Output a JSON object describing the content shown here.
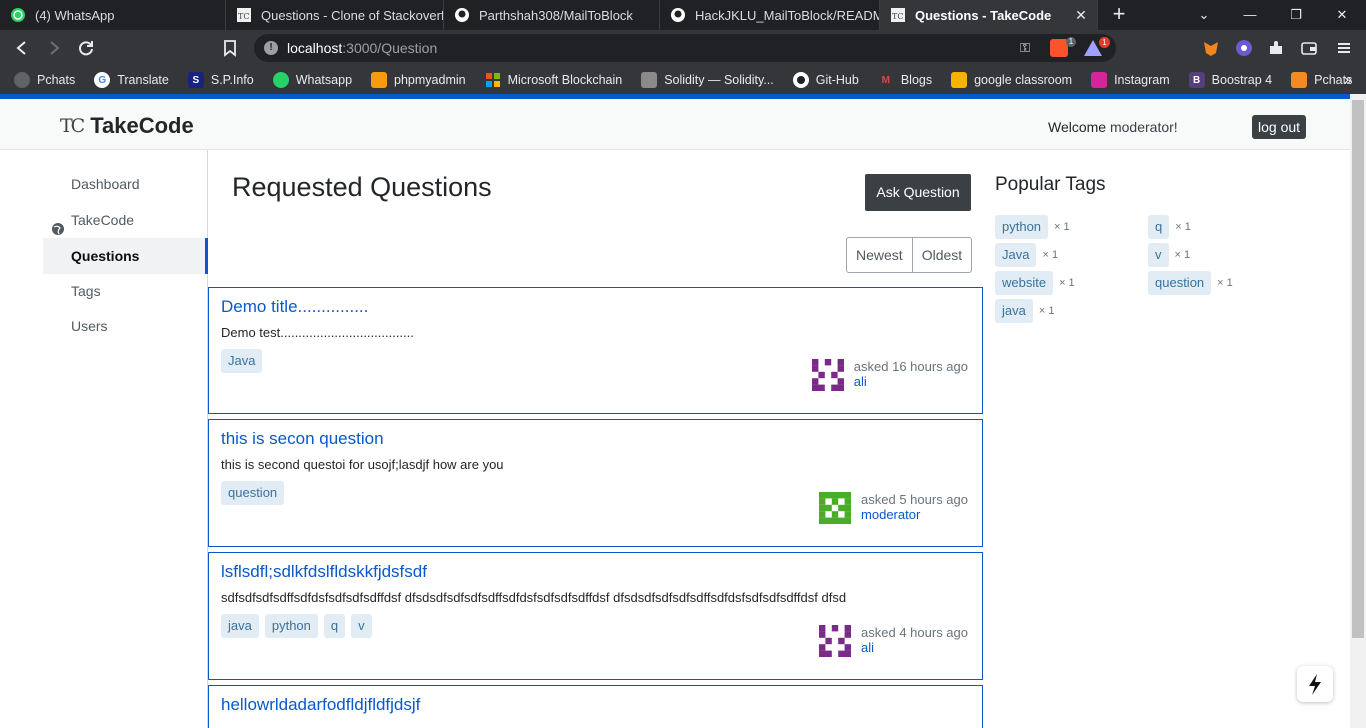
{
  "browser": {
    "tabs": [
      {
        "title": "(4) WhatsApp",
        "active": false
      },
      {
        "title": "Questions - Clone of Stackoverflow",
        "active": false
      },
      {
        "title": "Parthshah308/MailToBlock",
        "active": false
      },
      {
        "title": "HackJKLU_MailToBlock/README.md",
        "active": false
      },
      {
        "title": "Questions - TakeCode",
        "active": true
      }
    ],
    "url_host": "localhost",
    "url_rest": ":3000/Question",
    "brave_badge": "1",
    "rewards_badge": "1",
    "bookmarks": [
      "Pchats",
      "Translate",
      "S.P.Info",
      "Whatsapp",
      "phpmyadmin",
      "Microsoft Blockchain",
      "Solidity — Solidity...",
      "Git-Hub",
      "Blogs",
      "google classroom",
      "Instagram",
      "Boostrap 4",
      "Pchats"
    ]
  },
  "header": {
    "logo_mark": "TC",
    "brand": "TakeCode",
    "welcome_text": "Welcome",
    "username": "moderator!",
    "logout_label": "log out"
  },
  "nav": {
    "items": [
      {
        "label": "Dashboard"
      },
      {
        "label": "TakeCode"
      },
      {
        "label": "Questions"
      },
      {
        "label": "Tags"
      },
      {
        "label": "Users"
      }
    ]
  },
  "main": {
    "title": "Requested Questions",
    "ask_label": "Ask Question",
    "sort": [
      "Newest",
      "Oldest"
    ]
  },
  "questions": [
    {
      "title": "Demo title...............",
      "body": "Demo test.....................................",
      "tags": [
        "Java"
      ],
      "asked": "asked 16 hours ago",
      "user": "ali"
    },
    {
      "title": "this is secon question",
      "body": "this is second questoi  for usojf;lasdjf how are you",
      "tags": [
        "question"
      ],
      "asked": "asked 5 hours ago",
      "user": "moderator"
    },
    {
      "title": "lsflsdfl;sdlkfdslfldskkfjdsfsdf",
      "body": "sdfsdfsdfsdffsdfdsfsdfsdfsdffdsf dfsdsdfsdfsdfsdffsdfdsfsdfsdfsdffdsf dfsdsdfsdfsdfsdffsdfdsfsdfsdfsdffdsf dfsd",
      "tags": [
        "java",
        "python",
        "q",
        "v"
      ],
      "asked": "asked 4 hours ago",
      "user": "ali"
    },
    {
      "title": "hellowrldadarfodfldjfldfjdsjf",
      "body": "",
      "tags": [],
      "asked": "",
      "user": ""
    }
  ],
  "popular_tags": {
    "title": "Popular Tags",
    "left": [
      {
        "name": "python",
        "count": "× 1"
      },
      {
        "name": "Java",
        "count": "× 1"
      },
      {
        "name": "website",
        "count": "× 1"
      },
      {
        "name": "java",
        "count": "× 1"
      }
    ],
    "right": [
      {
        "name": "q",
        "count": "× 1"
      },
      {
        "name": "v",
        "count": "× 1"
      },
      {
        "name": "question",
        "count": "× 1"
      }
    ]
  },
  "colors": {
    "accent": "#0a58ca",
    "tag_bg": "#e1ecf4",
    "tag_text": "#39739d"
  }
}
